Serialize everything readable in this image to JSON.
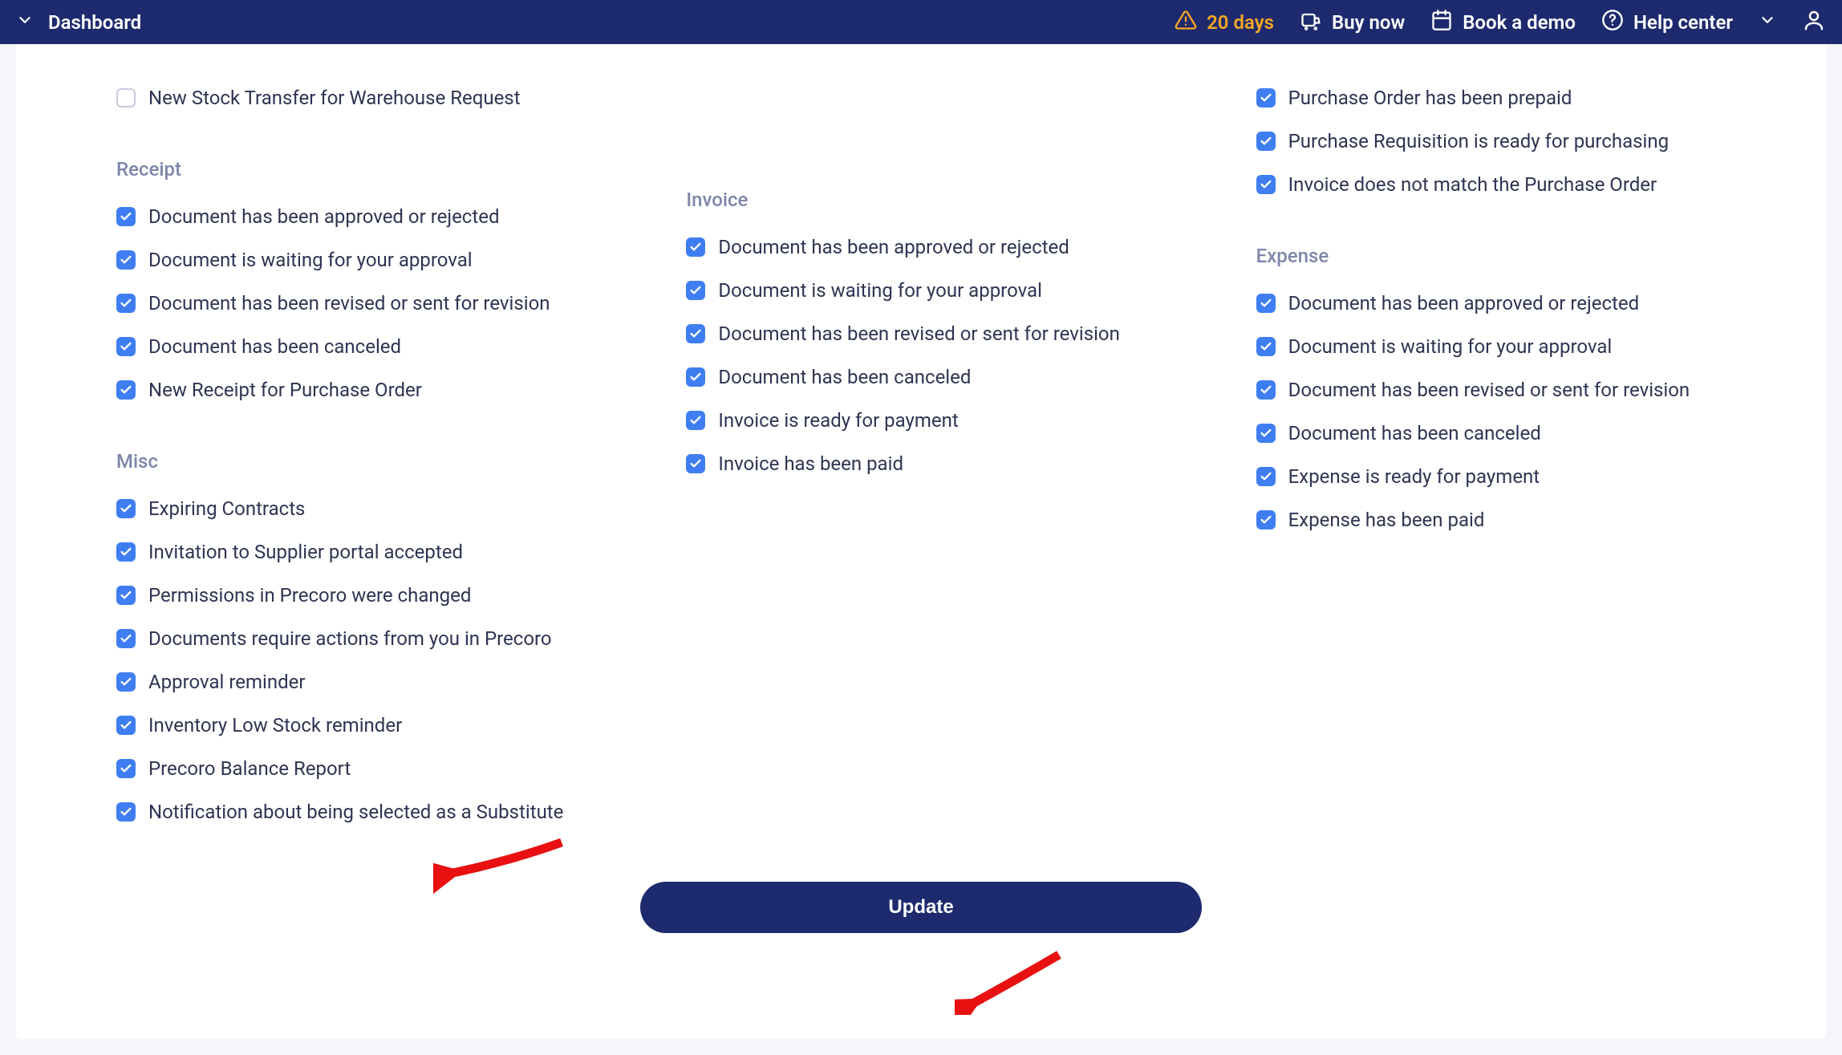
{
  "topbar": {
    "title": "Dashboard",
    "trial_days": "20 days",
    "buy_now": "Buy now",
    "book_demo": "Book a demo",
    "help_center": "Help center"
  },
  "col1_top": {
    "items": [
      {
        "label": "New Stock Transfer for Warehouse Request",
        "checked": false
      }
    ]
  },
  "col3_top": {
    "items": [
      {
        "label": "Purchase Order has been prepaid",
        "checked": true
      },
      {
        "label": "Purchase Requisition is ready for purchasing",
        "checked": true
      },
      {
        "label": "Invoice does not match the Purchase Order",
        "checked": true
      }
    ]
  },
  "receipt": {
    "title": "Receipt",
    "items": [
      {
        "label": "Document has been approved or rejected",
        "checked": true
      },
      {
        "label": "Document is waiting for your approval",
        "checked": true
      },
      {
        "label": "Document has been revised or sent for revision",
        "checked": true
      },
      {
        "label": "Document has been canceled",
        "checked": true
      },
      {
        "label": "New Receipt for Purchase Order",
        "checked": true
      }
    ]
  },
  "invoice": {
    "title": "Invoice",
    "items": [
      {
        "label": "Document has been approved or rejected",
        "checked": true
      },
      {
        "label": "Document is waiting for your approval",
        "checked": true
      },
      {
        "label": "Document has been revised or sent for revision",
        "checked": true
      },
      {
        "label": "Document has been canceled",
        "checked": true
      },
      {
        "label": "Invoice is ready for payment",
        "checked": true
      },
      {
        "label": "Invoice has been paid",
        "checked": true
      }
    ]
  },
  "expense": {
    "title": "Expense",
    "items": [
      {
        "label": "Document has been approved or rejected",
        "checked": true
      },
      {
        "label": "Document is waiting for your approval",
        "checked": true
      },
      {
        "label": "Document has been revised or sent for revision",
        "checked": true
      },
      {
        "label": "Document has been canceled",
        "checked": true
      },
      {
        "label": "Expense is ready for payment",
        "checked": true
      },
      {
        "label": "Expense has been paid",
        "checked": true
      }
    ]
  },
  "misc": {
    "title": "Misc",
    "items": [
      {
        "label": "Expiring Contracts",
        "checked": true
      },
      {
        "label": "Invitation to Supplier portal accepted",
        "checked": true
      },
      {
        "label": "Permissions in Precoro were changed",
        "checked": true
      },
      {
        "label": "Documents require actions from you in Precoro",
        "checked": true
      },
      {
        "label": "Approval reminder",
        "checked": true
      },
      {
        "label": "Inventory Low Stock reminder",
        "checked": true
      },
      {
        "label": "Precoro Balance Report",
        "checked": true
      },
      {
        "label": "Notification about being selected as a Substitute",
        "checked": true
      }
    ]
  },
  "footer": {
    "update_label": "Update"
  }
}
